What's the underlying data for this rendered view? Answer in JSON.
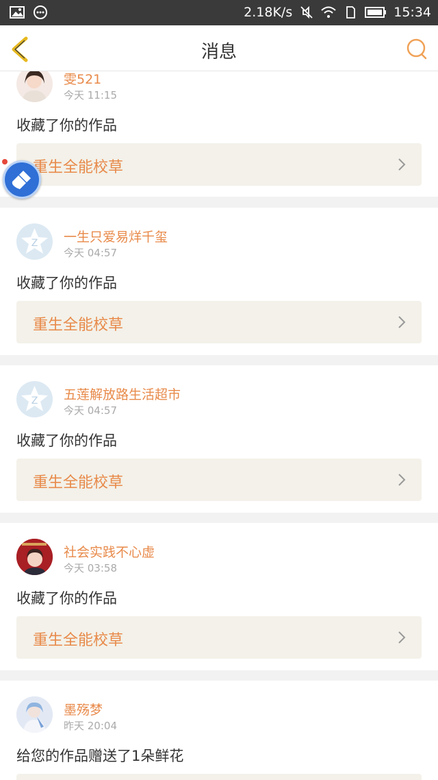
{
  "status_bar": {
    "speed": "2.18K/s",
    "time": "15:34"
  },
  "header": {
    "title": "消息"
  },
  "messages": [
    {
      "user": "雯521",
      "time": "今天 11:15",
      "action": "收藏了你的作品",
      "work": "重生全能校草"
    },
    {
      "user": "一生只爱易烊千玺",
      "time": "今天 04:57",
      "action": "收藏了你的作品",
      "work": "重生全能校草"
    },
    {
      "user": "五莲解放路生活超市",
      "time": "今天 04:57",
      "action": "收藏了你的作品",
      "work": "重生全能校草"
    },
    {
      "user": "社会实践不心虚",
      "time": "今天 03:58",
      "action": "收藏了你的作品",
      "work": "重生全能校草"
    },
    {
      "user": "墨殇梦",
      "time": "昨天 20:04",
      "action": "给您的作品赠送了1朵鲜花",
      "work": ""
    }
  ],
  "colors": {
    "accent": "#e88a4a",
    "work_bg": "#f3f1e9",
    "status_bar": "#3a3a3a"
  }
}
